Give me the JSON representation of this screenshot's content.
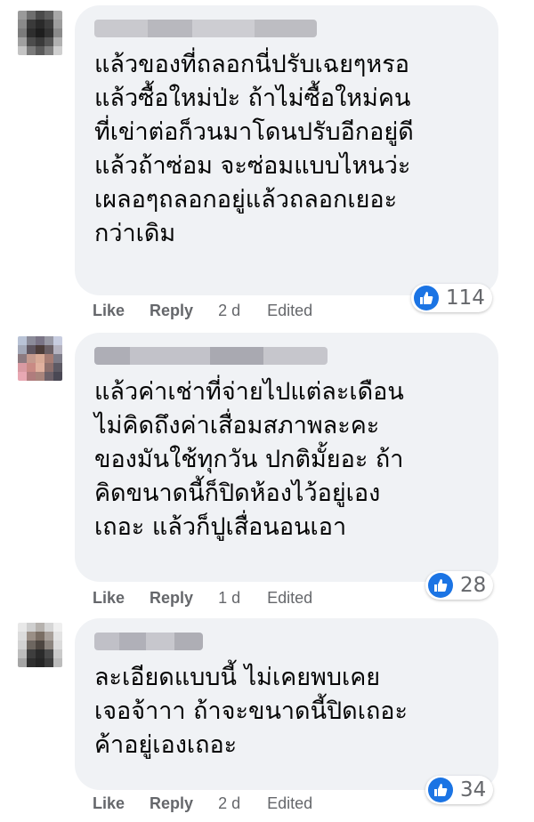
{
  "comments": [
    {
      "text": "แล้วของที่ถลอกนี่ปรับเฉยๆหรอ\nแล้วซื้อใหม่ป่ะ ถ้าไม่ซื้อใหม่คน\nที่เข่าต่อก็วนมาโดนปรับอีกอยู่ดี\nแล้วถ้าซ่อม จะซ่อมแบบไหนว่ะ\nเผลอๆถลอกอยู่แล้วถลอกเยอะ\nกว่าเดิม",
      "reaction_count": "114",
      "like_label": "Like",
      "reply_label": "Reply",
      "time": "2 d",
      "edited_label": "Edited"
    },
    {
      "text": "แล้วค่าเช่าที่จ่ายไปแต่ละเดือน\nไม่คิดถึงค่าเสื่อมสภาพละคะ\nของมันใช้ทุกวัน ปกติมั้ยอะ ถ้า\nคิดขนาดนี้ก็ปิดห้องไว้อยู่เอง\nเถอะ แล้วก็ปูเสื่อนอนเอา",
      "reaction_count": "28",
      "like_label": "Like",
      "reply_label": "Reply",
      "time": "1 d",
      "edited_label": "Edited"
    },
    {
      "text": "ละเอียดแบบนี้ ไม่เคยพบเคย\nเจอจ้าาา ถ้าจะขนาดนี้ปิดเถอะ\nค้าอยู่เองเถอะ",
      "reaction_count": "34",
      "like_label": "Like",
      "reply_label": "Reply",
      "time": "2 d",
      "edited_label": "Edited"
    }
  ],
  "colors": {
    "bubble": "#f0f2f5",
    "like_blue": "#1b74e4",
    "meta_gray": "#65676b",
    "text": "#050505"
  },
  "icons": {
    "reaction": "thumbs-up-icon"
  }
}
